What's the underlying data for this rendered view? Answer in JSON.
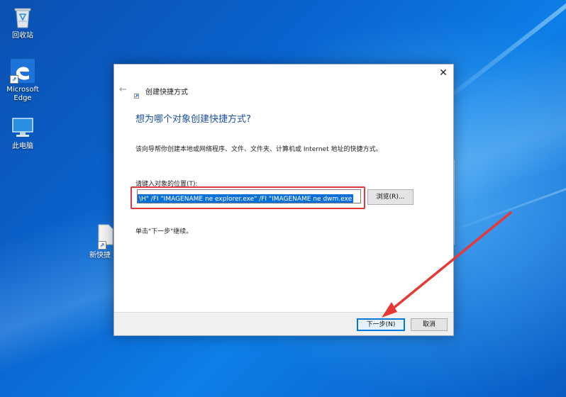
{
  "desktop": {
    "icons": [
      {
        "label": "回收站",
        "icon": "recycle-bin-icon"
      },
      {
        "label": "Microsoft\nEdge",
        "icon": "edge-icon"
      },
      {
        "label": "此电脑",
        "icon": "computer-icon"
      },
      {
        "label": "新快捷",
        "icon": "new-shortcut-file-icon"
      }
    ]
  },
  "dialog": {
    "window_title": "创建快捷方式",
    "close_glyph": "✕",
    "back_glyph": "←",
    "heading": "想为哪个对象创建快捷方式?",
    "description": "该向导帮你创建本地或网络程序、文件、文件夹、计算机或 Internet 地址的快捷方式。",
    "location_label": "请键入对象的位置(T):",
    "location_value": "\\H\" /FI \"IMAGENAME ne explorer.exe\" /FI \"IMAGENAME ne dwm.exe",
    "browse_label": "浏览(R)...",
    "continue_hint": "单击\"下一步\"继续。",
    "next_label": "下一步(N)",
    "cancel_label": "取消"
  },
  "colors": {
    "heading": "#1c4f9c",
    "highlight": "#e0383c",
    "selection": "#0a6fd6",
    "annotation_arrow": "#e53935"
  }
}
